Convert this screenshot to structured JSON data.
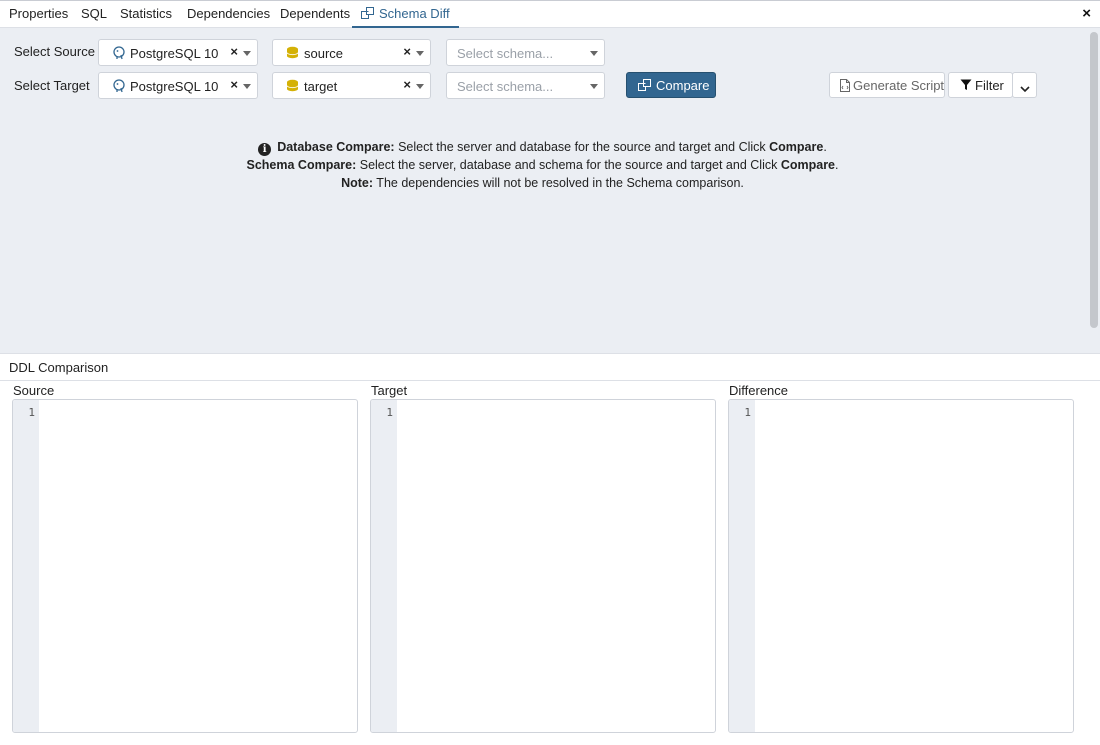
{
  "tabs": [
    {
      "label": "Properties"
    },
    {
      "label": "SQL"
    },
    {
      "label": "Statistics"
    },
    {
      "label": "Dependencies"
    },
    {
      "label": "Dependents"
    },
    {
      "label": "Schema Diff",
      "active": true
    }
  ],
  "close_label": "×",
  "source_row": {
    "label": "Select Source",
    "server": "PostgreSQL 10",
    "database": "source",
    "schema_placeholder": "Select schema..."
  },
  "target_row": {
    "label": "Select Target",
    "server": "PostgreSQL 10",
    "database": "target",
    "schema_placeholder": "Select schema..."
  },
  "clear_label": "×",
  "buttons": {
    "compare": "Compare",
    "generate_script": "Generate Script",
    "filter": "Filter"
  },
  "info": {
    "db_compare_title": "Database Compare:",
    "db_compare_text": " Select the server and database for the source and target and Click ",
    "db_compare_bold": "Compare",
    "db_compare_end": ".",
    "schema_compare_title": "Schema Compare:",
    "schema_compare_text": " Select the server, database and schema for the source and target and Click ",
    "schema_compare_bold": "Compare",
    "schema_compare_end": ".",
    "note_title": "Note:",
    "note_text": " The dependencies will not be resolved in the Schema comparison."
  },
  "ddl": {
    "title": "DDL Comparison",
    "columns": [
      {
        "label": "Source",
        "line": "1"
      },
      {
        "label": "Target",
        "line": "1"
      },
      {
        "label": "Difference",
        "line": "1"
      }
    ]
  },
  "colors": {
    "accent": "#326690",
    "panel_bg": "#ebeef3",
    "database_icon": "#d4b106"
  }
}
